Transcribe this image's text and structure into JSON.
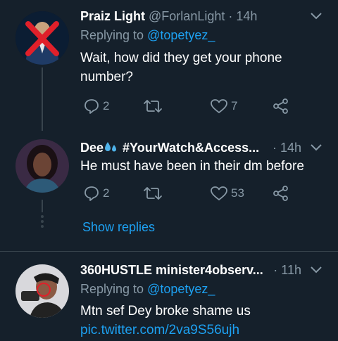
{
  "colors": {
    "background": "#15202b",
    "muted": "#8899a6",
    "accent": "#1da1f2",
    "thread_line": "#38444d"
  },
  "tweets": [
    {
      "display_name": "Praiz Light",
      "handle": "@ForlanLight",
      "time": "· 14h",
      "replying_prefix": "Replying to",
      "replying_handle": "@topetyez_",
      "text": "Wait, how did they get your phone number?",
      "replies": "2",
      "retweets": "",
      "likes": "7",
      "avatar_icon": "avatar-red-x"
    },
    {
      "display_name": "Dee",
      "display_name_suffix": "#YourWatch&Access...",
      "time": "· 14h",
      "text": "He must have been in their dm before",
      "replies": "2",
      "retweets": "",
      "likes": "53",
      "avatar_icon": "avatar-woman"
    },
    {
      "display_name": "360HUSTLE minister4observ...",
      "time": "· 11h",
      "replying_prefix": "Replying to",
      "replying_handle": "@topetyez_",
      "text": "Mtn sef Dey broke shame us",
      "link": "pic.twitter.com/2va9S56ujh",
      "avatar_icon": "avatar-person"
    }
  ],
  "show_replies_label": "Show replies"
}
